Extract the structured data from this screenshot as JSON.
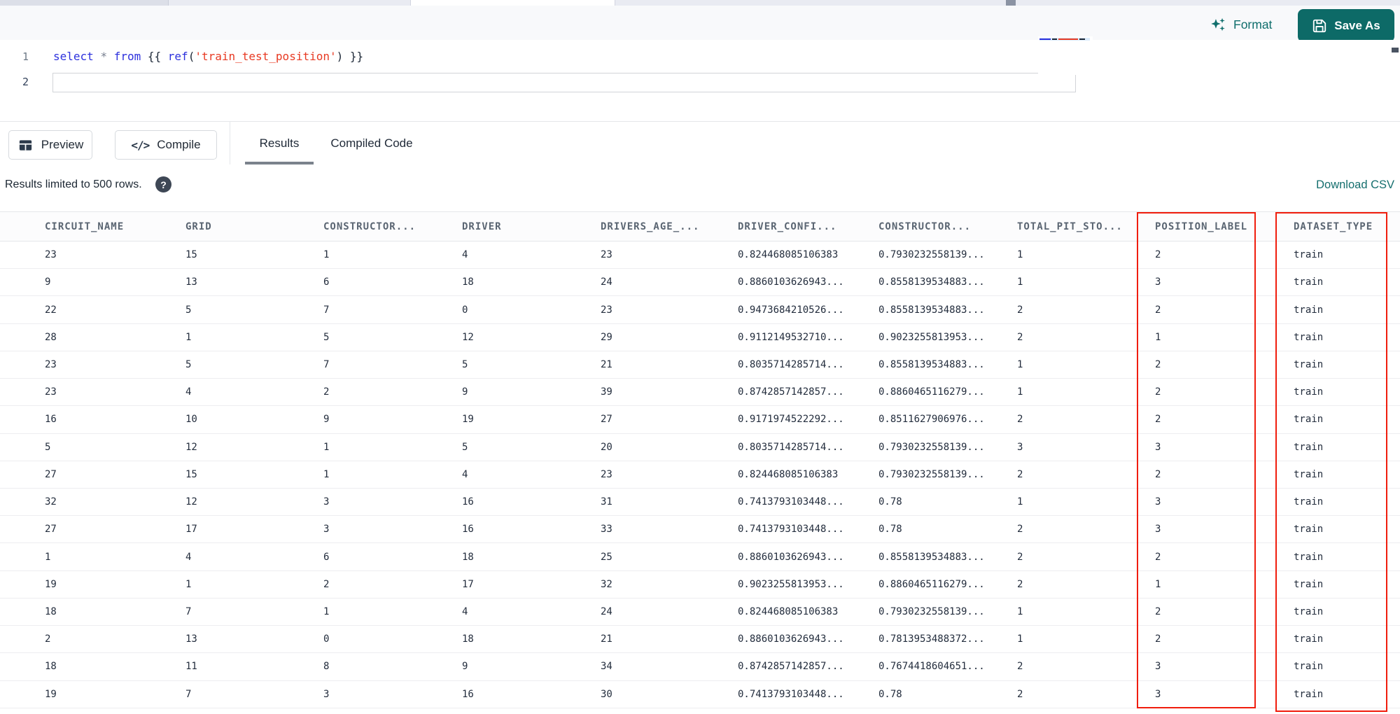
{
  "editor": {
    "format_label": "Format",
    "save_as_label": "Save As",
    "line1_number": "1",
    "line2_number": "2",
    "code_tokens": [
      {
        "text": "select",
        "type": "kw"
      },
      {
        "text": " ",
        "type": "pl"
      },
      {
        "text": "*",
        "type": "op"
      },
      {
        "text": " ",
        "type": "pl"
      },
      {
        "text": "from",
        "type": "kw"
      },
      {
        "text": " {{ ",
        "type": "pl"
      },
      {
        "text": "ref",
        "type": "fn"
      },
      {
        "text": "(",
        "type": "pl"
      },
      {
        "text": "'train_test_position'",
        "type": "str"
      },
      {
        "text": ")",
        "type": "pl"
      },
      {
        "text": " }}",
        "type": "pl"
      }
    ]
  },
  "toolbar": {
    "preview_label": "Preview",
    "compile_label": "Compile",
    "compile_glyph": "</>",
    "tabs": [
      {
        "label": "Results",
        "active": true
      },
      {
        "label": "Compiled Code",
        "active": false
      }
    ]
  },
  "results_info": {
    "limit_text": "Results limited to 500 rows.",
    "help_glyph": "?",
    "download_csv_label": "Download CSV"
  },
  "table": {
    "columns": [
      "CIRCUIT_NAME",
      "GRID",
      "CONSTRUCTOR...",
      "DRIVER",
      "DRIVERS_AGE_...",
      "DRIVER_CONFI...",
      "CONSTRUCTOR...",
      "TOTAL_PIT_STO...",
      "POSITION_LABEL",
      "DATASET_TYPE"
    ],
    "highlighted_columns": [
      "POSITION_LABEL",
      "DATASET_TYPE"
    ],
    "rows": [
      [
        "23",
        "15",
        "1",
        "4",
        "23",
        "0.824468085106383",
        "0.7930232558139...",
        "1",
        "2",
        "train"
      ],
      [
        "9",
        "13",
        "6",
        "18",
        "24",
        "0.8860103626943...",
        "0.8558139534883...",
        "1",
        "3",
        "train"
      ],
      [
        "22",
        "5",
        "7",
        "0",
        "23",
        "0.9473684210526...",
        "0.8558139534883...",
        "2",
        "2",
        "train"
      ],
      [
        "28",
        "1",
        "5",
        "12",
        "29",
        "0.9112149532710...",
        "0.9023255813953...",
        "2",
        "1",
        "train"
      ],
      [
        "23",
        "5",
        "7",
        "5",
        "21",
        "0.8035714285714...",
        "0.8558139534883...",
        "1",
        "2",
        "train"
      ],
      [
        "23",
        "4",
        "2",
        "9",
        "39",
        "0.8742857142857...",
        "0.8860465116279...",
        "1",
        "2",
        "train"
      ],
      [
        "16",
        "10",
        "9",
        "19",
        "27",
        "0.9171974522292...",
        "0.8511627906976...",
        "2",
        "2",
        "train"
      ],
      [
        "5",
        "12",
        "1",
        "5",
        "20",
        "0.8035714285714...",
        "0.7930232558139...",
        "3",
        "3",
        "train"
      ],
      [
        "27",
        "15",
        "1",
        "4",
        "23",
        "0.824468085106383",
        "0.7930232558139...",
        "2",
        "2",
        "train"
      ],
      [
        "32",
        "12",
        "3",
        "16",
        "31",
        "0.7413793103448...",
        "0.78",
        "1",
        "3",
        "train"
      ],
      [
        "27",
        "17",
        "3",
        "16",
        "33",
        "0.7413793103448...",
        "0.78",
        "2",
        "3",
        "train"
      ],
      [
        "1",
        "4",
        "6",
        "18",
        "25",
        "0.8860103626943...",
        "0.8558139534883...",
        "2",
        "2",
        "train"
      ],
      [
        "19",
        "1",
        "2",
        "17",
        "32",
        "0.9023255813953...",
        "0.8860465116279...",
        "2",
        "1",
        "train"
      ],
      [
        "18",
        "7",
        "1",
        "4",
        "24",
        "0.824468085106383",
        "0.7930232558139...",
        "1",
        "2",
        "train"
      ],
      [
        "2",
        "13",
        "0",
        "18",
        "21",
        "0.8860103626943...",
        "0.7813953488372...",
        "1",
        "2",
        "train"
      ],
      [
        "18",
        "11",
        "8",
        "9",
        "34",
        "0.8742857142857...",
        "0.7674418604651...",
        "2",
        "3",
        "train"
      ],
      [
        "19",
        "7",
        "3",
        "16",
        "30",
        "0.7413793103448...",
        "0.78",
        "2",
        "3",
        "train"
      ]
    ]
  },
  "icons": {
    "format": "sparkles-icon",
    "save_as": "floppy-disk-icon",
    "preview": "table-grid-icon",
    "compile": "code-slash-icon",
    "help": "question-mark-icon"
  },
  "colors": {
    "accent_teal": "#0d6a67",
    "highlight_red": "#f01d0d",
    "keyword_blue": "#2d31dd",
    "string_red": "#e83a23",
    "header_gray": "#5a6572",
    "cell_text": "#232d3d"
  }
}
